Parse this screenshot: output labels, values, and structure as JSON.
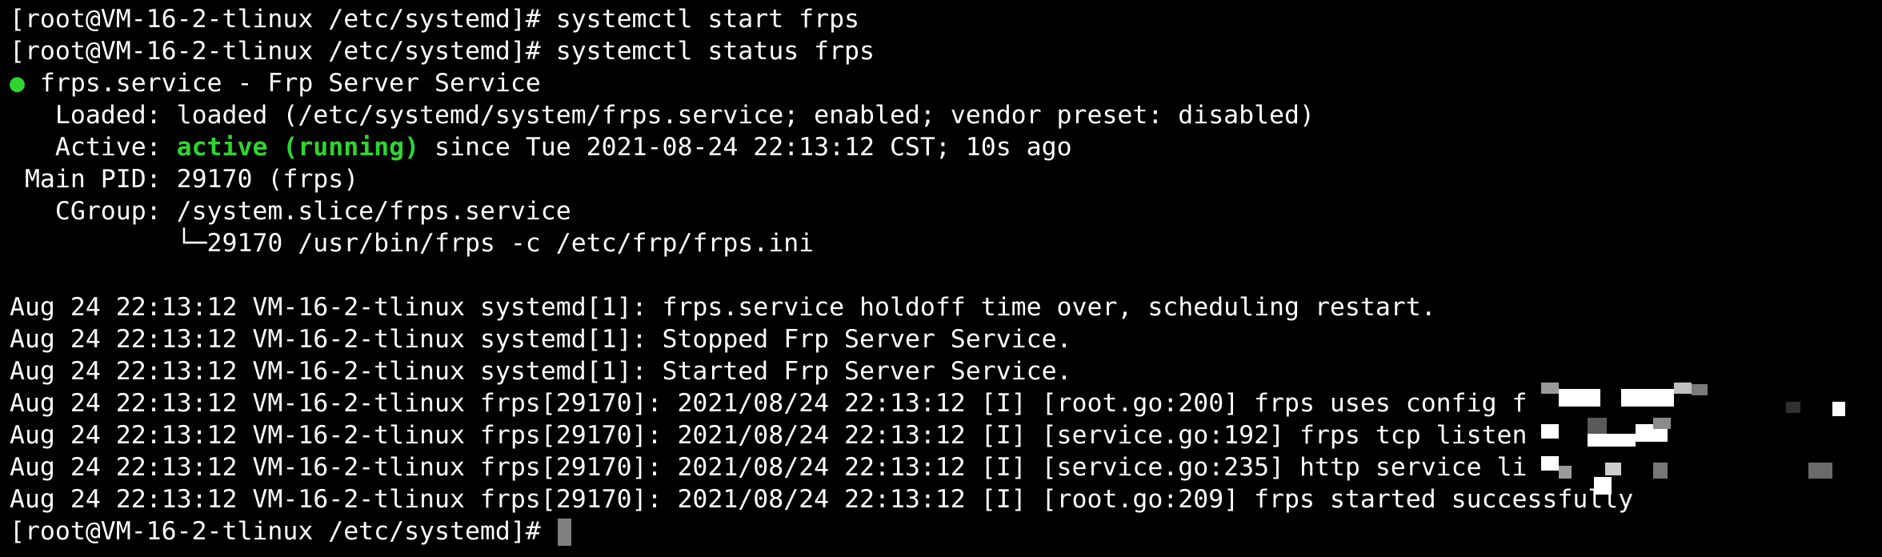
{
  "terminal": {
    "lines": [
      "[root@VM-16-2-tlinux /etc/systemd]# systemctl start frps",
      "[root@VM-16-2-tlinux /etc/systemd]# systemctl status frps"
    ],
    "status": {
      "dot": "●",
      "unit_title": " frps.service - Frp Server Service",
      "loaded": "   Loaded: loaded (/etc/systemd/system/frps.service; enabled; vendor preset: disabled)",
      "active_prefix": "   Active: ",
      "active_state": "active (running)",
      "active_suffix": " since Tue 2021-08-24 22:13:12 CST; 10s ago",
      "main_pid": " Main PID: 29170 (frps)",
      "cgroup": "   CGroup: /system.slice/frps.service",
      "cgroup_child": "           └─29170 /usr/bin/frps -c /etc/frp/frps.ini"
    },
    "log_lines": [
      "Aug 24 22:13:12 VM-16-2-tlinux systemd[1]: frps.service holdoff time over, scheduling restart.",
      "Aug 24 22:13:12 VM-16-2-tlinux systemd[1]: Stopped Frp Server Service.",
      "Aug 24 22:13:12 VM-16-2-tlinux systemd[1]: Started Frp Server Service.",
      "Aug 24 22:13:12 VM-16-2-tlinux frps[29170]: 2021/08/24 22:13:12 [I] [root.go:200] frps uses config f",
      "Aug 24 22:13:12 VM-16-2-tlinux frps[29170]: 2021/08/24 22:13:12 [I] [service.go:192] frps tcp listen",
      "Aug 24 22:13:12 VM-16-2-tlinux frps[29170]: 2021/08/24 22:13:12 [I] [service.go:235] http service li",
      "Aug 24 22:13:12 VM-16-2-tlinux frps[29170]: 2021/08/24 22:13:12 [I] [root.go:209] frps started successfully"
    ],
    "prompt": "[root@VM-16-2-tlinux /etc/systemd]# "
  },
  "colors": {
    "background": "#000000",
    "foreground": "#ffffff",
    "status_green": "#2fd52f",
    "cursor": "#7f7f7f"
  }
}
